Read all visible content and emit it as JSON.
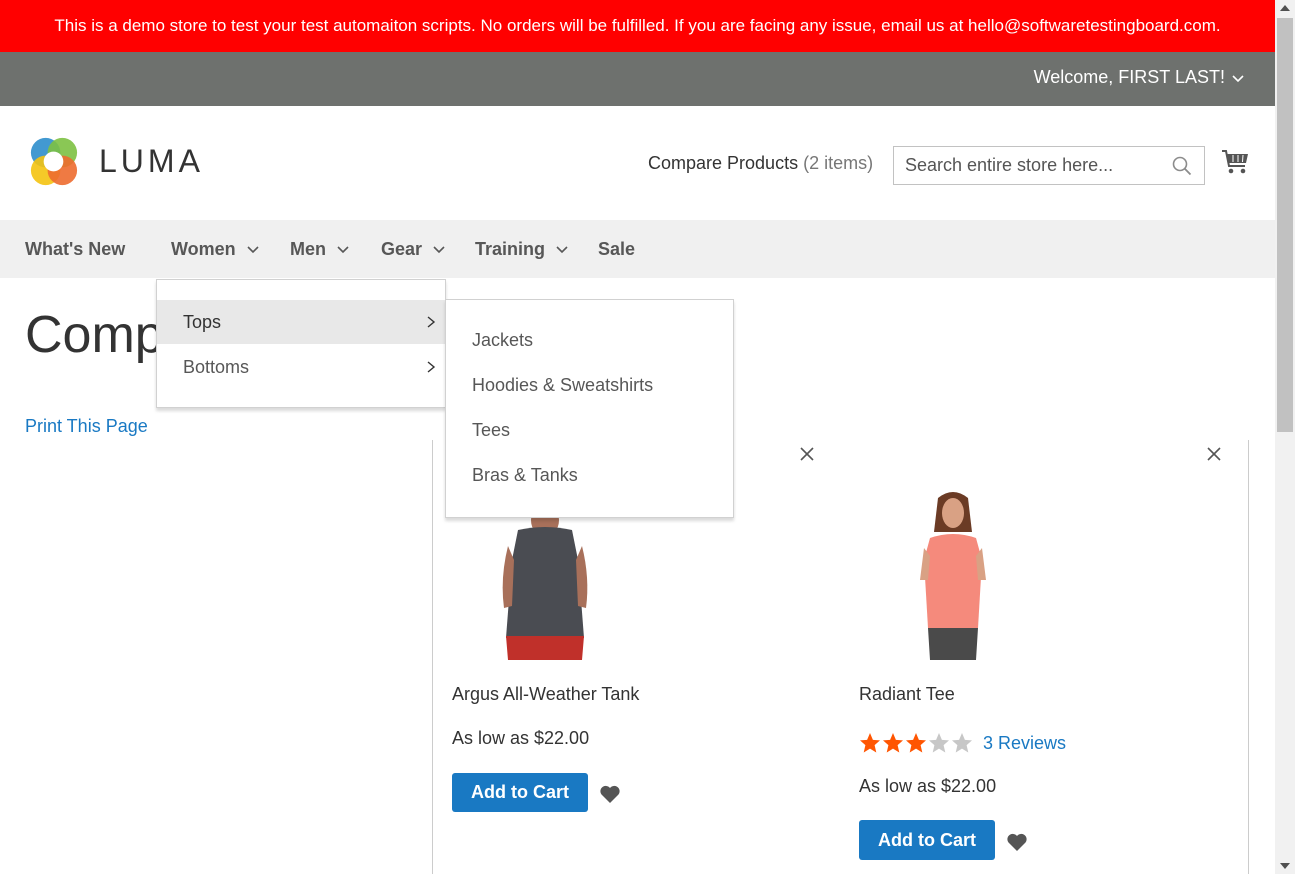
{
  "demo_notice": "This is a demo store to test your test automaiton scripts. No orders will be fulfilled. If you are facing any issue, email us at hello@softwaretestingboard.com.",
  "header": {
    "welcome": "Welcome, FIRST LAST!"
  },
  "logo": {
    "text": "LUMA"
  },
  "compare": {
    "label": "Compare Products",
    "count": "(2 items)"
  },
  "search": {
    "placeholder": "Search entire store here..."
  },
  "nav": {
    "items": [
      {
        "label": "What's New"
      },
      {
        "label": "Women"
      },
      {
        "label": "Men"
      },
      {
        "label": "Gear"
      },
      {
        "label": "Training"
      },
      {
        "label": "Sale"
      }
    ]
  },
  "women_menu": {
    "items": [
      {
        "label": "Tops"
      },
      {
        "label": "Bottoms"
      }
    ]
  },
  "tops_menu": {
    "items": [
      {
        "label": "Jackets"
      },
      {
        "label": "Hoodies & Sweatshirts"
      },
      {
        "label": "Tees"
      },
      {
        "label": "Bras & Tanks"
      }
    ]
  },
  "page": {
    "title": "Comp",
    "print_link": "Print This Page"
  },
  "products": [
    {
      "name": "Argus All-Weather Tank",
      "price": "As low as $22.00",
      "add_to_cart": "Add to Cart"
    },
    {
      "name": "Radiant Tee",
      "rating_stars": 3,
      "rating_max": 5,
      "reviews": "3 Reviews",
      "price": "As low as $22.00",
      "add_to_cart": "Add to Cart"
    }
  ],
  "colors": {
    "demo_bar": "#ff0000",
    "header_panel": "#6e716e",
    "primary_button": "#1979c3",
    "link": "#1979c3",
    "star_filled": "#ff5501",
    "star_empty": "#c7c7c7"
  },
  "icons": [
    "chevron-down-icon",
    "search-icon",
    "cart-icon",
    "chevron-right-icon",
    "close-icon",
    "heart-icon",
    "star-icon"
  ]
}
